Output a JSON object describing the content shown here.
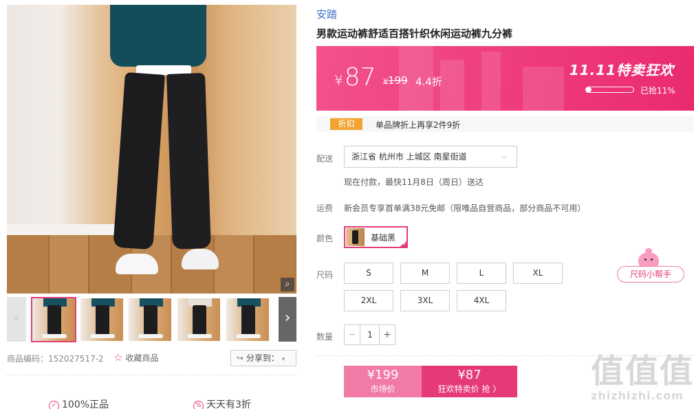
{
  "product": {
    "brand": "安踏",
    "title": "男款运动裤舒适百搭针织休闲运动裤九分裤",
    "sku_code": "商品编码：152027517-2",
    "favorite_label": "收藏商品",
    "share_label": "分享到："
  },
  "promo": {
    "currency": "¥",
    "current_price": "87",
    "original_price": "199",
    "discount": "4.4折",
    "event_title": "11.11特卖狂欢",
    "sold_progress": 0.11,
    "sold_text": "已抢11%",
    "background_color": "#ef3f80"
  },
  "discount_strip": {
    "tag": "折扣",
    "text": "单品牌折上再享2件9折"
  },
  "shipping": {
    "label": "配送",
    "address": "浙江省 杭州市 上城区 南星街道",
    "eta": "现在付款，最快11月8日（周日）送达"
  },
  "freight": {
    "label": "运费",
    "text": "新会员专享首单满38元免邮（限唯品自营商品，部分商品不可用）"
  },
  "color": {
    "label": "颜色",
    "selected": "基础黑"
  },
  "size": {
    "label": "尺码",
    "options": [
      "S",
      "M",
      "L",
      "XL",
      "2XL",
      "3XL",
      "4XL"
    ],
    "helper": "尺码小帮手"
  },
  "quantity": {
    "label": "数量",
    "value": "1"
  },
  "buy": {
    "market_price": "¥199",
    "market_label": "市场价",
    "sale_price": "¥87",
    "sale_label": "狂欢特卖价 抢 〉"
  },
  "guarantees": [
    "100%正品",
    "天天有3折"
  ],
  "watermark": {
    "big": "值值值",
    "small": "zhizhizhi.com"
  },
  "icons": {
    "zoom": "search-icon",
    "prev": "chevron-left-icon",
    "next": "chevron-right-icon",
    "favorite": "star-icon",
    "share": "share-icon",
    "select": "chevron-down-icon"
  },
  "accent_color": "#e23c7c"
}
